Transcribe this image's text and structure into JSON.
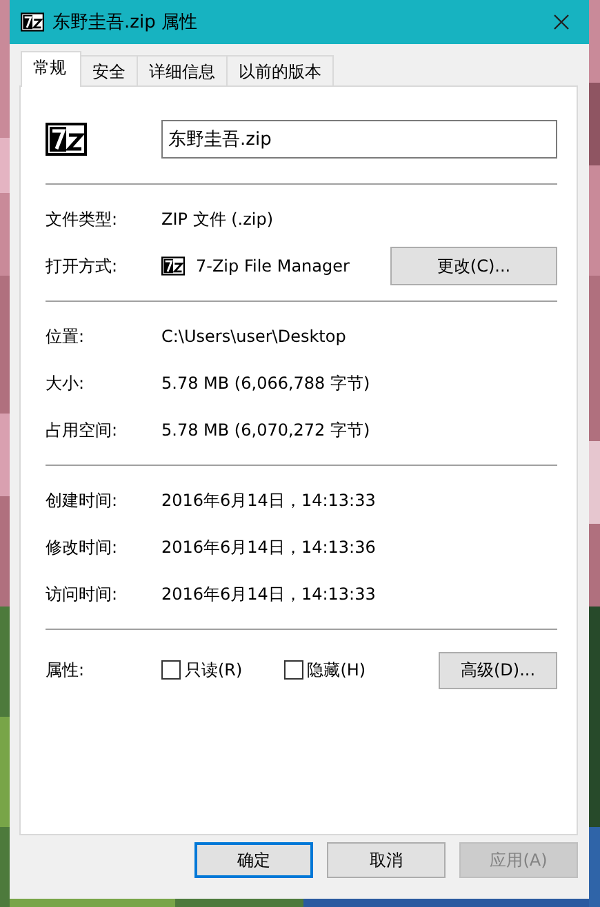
{
  "window": {
    "title": "东野圭吾.zip 属性"
  },
  "tabs": [
    {
      "label": "常规",
      "selected": true
    },
    {
      "label": "安全",
      "selected": false
    },
    {
      "label": "详细信息",
      "selected": false
    },
    {
      "label": "以前的版本",
      "selected": false
    }
  ],
  "general": {
    "file_name": {
      "value": "东野圭吾.zip"
    },
    "sections": [
      [
        {
          "kind": "text",
          "label": "文件类型:",
          "value": "ZIP 文件 (.zip)"
        },
        {
          "kind": "app",
          "label": "打开方式:",
          "value": "7-Zip File Manager",
          "button": "更改(C)..."
        }
      ],
      [
        {
          "kind": "text",
          "label": "位置:",
          "value": "C:\\Users\\user\\Desktop"
        },
        {
          "kind": "text",
          "label": "大小:",
          "value": "5.78 MB (6,066,788 字节)"
        },
        {
          "kind": "text",
          "label": "占用空间:",
          "value": "5.78 MB (6,070,272 字节)"
        }
      ],
      [
        {
          "kind": "text",
          "label": "创建时间:",
          "value": "2016年6月14日，14:13:33"
        },
        {
          "kind": "text",
          "label": "修改时间:",
          "value": "2016年6月14日，14:13:36"
        },
        {
          "kind": "text",
          "label": "访问时间:",
          "value": "2016年6月14日，14:13:33"
        }
      ]
    ],
    "attributes": {
      "label": "属性:",
      "checkboxes": [
        {
          "label": "只读(R)",
          "checked": false
        },
        {
          "label": "隐藏(H)",
          "checked": false
        }
      ],
      "button": "高级(D)..."
    }
  },
  "buttons": [
    {
      "label": "确定",
      "default": true,
      "disabled": false
    },
    {
      "label": "取消",
      "default": false,
      "disabled": false
    },
    {
      "label": "应用(A)",
      "default": false,
      "disabled": true
    }
  ]
}
